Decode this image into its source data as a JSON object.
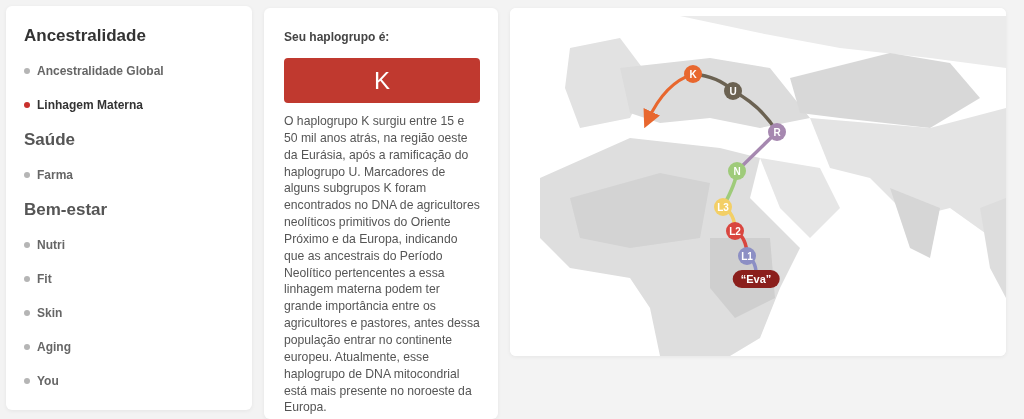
{
  "sidebar": {
    "sections": [
      {
        "title": "Ancestralidade",
        "items": [
          {
            "label": "Ancestralidade Global",
            "selected": false
          },
          {
            "label": "Linhagem Materna",
            "selected": true
          }
        ]
      },
      {
        "title": "Saúde",
        "items": [
          {
            "label": "Farma",
            "selected": false
          }
        ]
      },
      {
        "title": "Bem-estar",
        "items": [
          {
            "label": "Nutri",
            "selected": false
          },
          {
            "label": "Fit",
            "selected": false
          },
          {
            "label": "Skin",
            "selected": false
          },
          {
            "label": "Aging",
            "selected": false
          },
          {
            "label": "You",
            "selected": false
          }
        ]
      }
    ]
  },
  "result": {
    "heading": "Seu haplogrupo é:",
    "haplogroup": "K",
    "description": "O haplogrupo K surgiu entre 15 e 50 mil anos atrás, na região oeste da Eurásia, após a ramificação do haplogrupo U. Marcadores de alguns subgrupos K foram encontrados no DNA de agricultores neolíticos primitivos do Oriente Próximo e da Europa, indicando que as ancestrais do Período Neolítico pertencentes a essa linhagem materna podem ter grande importância entre os agricultores e pastores, antes dessa população entrar no continente europeu. Atualmente, esse haplogrupo de DNA mitocondrial está mais presente no noroeste da Europa."
  },
  "map": {
    "route": [
      {
        "label": "K",
        "color": "#e8672e",
        "kind": "node"
      },
      {
        "label": "U",
        "color": "#6b6252",
        "kind": "node"
      },
      {
        "label": "R",
        "color": "#a688b0",
        "kind": "node"
      },
      {
        "label": "N",
        "color": "#9fcb7a",
        "kind": "node"
      },
      {
        "label": "L3",
        "color": "#f3cf66",
        "kind": "node"
      },
      {
        "label": "L2",
        "color": "#d9463f",
        "kind": "node"
      },
      {
        "label": "L1",
        "color": "#8c8fc4",
        "kind": "node"
      },
      {
        "label": "“Eva”",
        "color": "#8b1f1c",
        "kind": "origin"
      }
    ]
  }
}
